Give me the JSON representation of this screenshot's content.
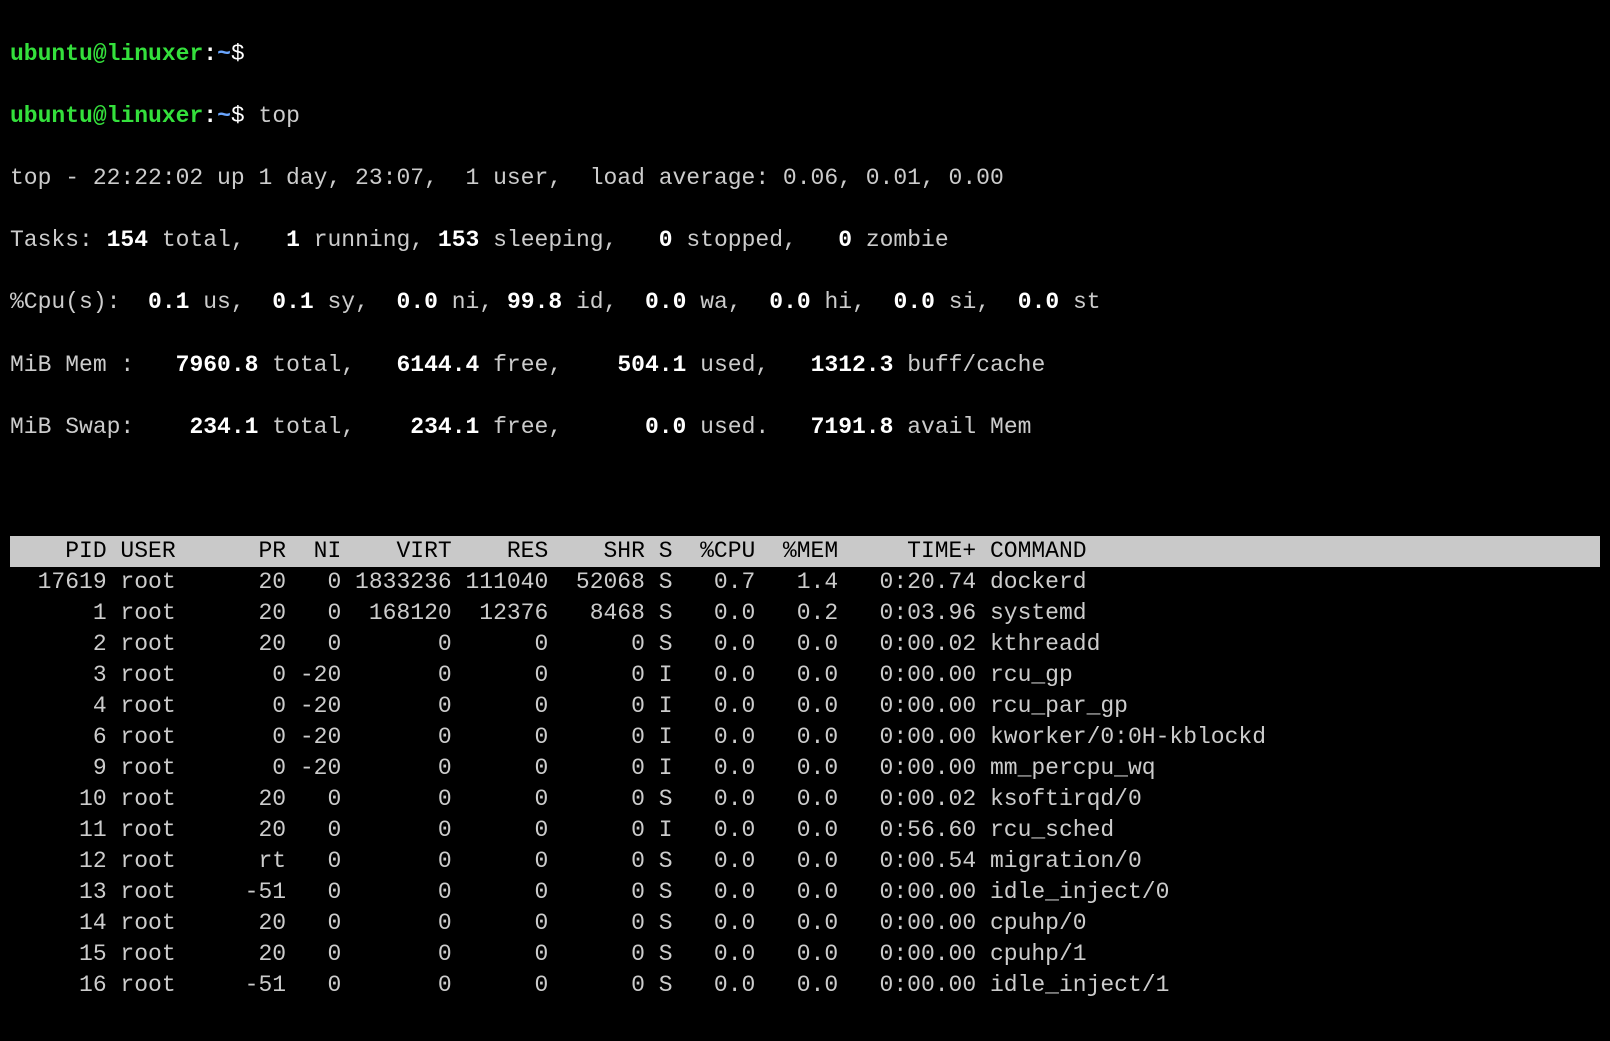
{
  "prompt": {
    "user": "ubuntu",
    "at": "@",
    "host": "linuxer",
    "colon": ":",
    "path": "~",
    "dollar": "$"
  },
  "commands": {
    "blank": "",
    "top": "top"
  },
  "summary": {
    "l1_a": "top - 22:22:02 up 1 day, 23:07,  1 user,  load average: 0.06, 0.01, 0.00",
    "tasks_label": "Tasks:",
    "tasks_total": " 154 ",
    "tasks_total_lbl": "total,",
    "tasks_run": "   1 ",
    "tasks_run_lbl": "running,",
    "tasks_sleep": " 153 ",
    "tasks_sleep_lbl": "sleeping,",
    "tasks_stop": "   0 ",
    "tasks_stop_lbl": "stopped,",
    "tasks_zomb": "   0 ",
    "tasks_zomb_lbl": "zombie",
    "cpu_label": "%Cpu(s):",
    "cpu_us": "  0.1 ",
    "cpu_us_lbl": "us,",
    "cpu_sy": "  0.1 ",
    "cpu_sy_lbl": "sy,",
    "cpu_ni": "  0.0 ",
    "cpu_ni_lbl": "ni,",
    "cpu_id": " 99.8 ",
    "cpu_id_lbl": "id,",
    "cpu_wa": "  0.0 ",
    "cpu_wa_lbl": "wa,",
    "cpu_hi": "  0.0 ",
    "cpu_hi_lbl": "hi,",
    "cpu_si": "  0.0 ",
    "cpu_si_lbl": "si,",
    "cpu_st": "  0.0 ",
    "cpu_st_lbl": "st",
    "mem_label": "MiB Mem :",
    "mem_total": "   7960.8 ",
    "mem_total_lbl": "total,",
    "mem_free": "   6144.4 ",
    "mem_free_lbl": "free,",
    "mem_used": "    504.1 ",
    "mem_used_lbl": "used,",
    "mem_buff": "   1312.3 ",
    "mem_buff_lbl": "buff/cache",
    "swap_label": "MiB Swap:",
    "swap_total": "    234.1 ",
    "swap_total_lbl": "total,",
    "swap_free": "    234.1 ",
    "swap_free_lbl": "free,",
    "swap_used": "      0.0 ",
    "swap_used_lbl": "used.",
    "swap_avail": "   7191.8 ",
    "swap_avail_lbl": "avail Mem"
  },
  "header": "    PID USER      PR  NI    VIRT    RES    SHR S  %CPU  %MEM     TIME+ COMMAND                         ",
  "rows": [
    "  17619 root      20   0 1833236 111040  52068 S   0.7   1.4   0:20.74 dockerd",
    "      1 root      20   0  168120  12376   8468 S   0.0   0.2   0:03.96 systemd",
    "      2 root      20   0       0      0      0 S   0.0   0.0   0:00.02 kthreadd",
    "      3 root       0 -20       0      0      0 I   0.0   0.0   0:00.00 rcu_gp",
    "      4 root       0 -20       0      0      0 I   0.0   0.0   0:00.00 rcu_par_gp",
    "      6 root       0 -20       0      0      0 I   0.0   0.0   0:00.00 kworker/0:0H-kblockd",
    "      9 root       0 -20       0      0      0 I   0.0   0.0   0:00.00 mm_percpu_wq",
    "     10 root      20   0       0      0      0 S   0.0   0.0   0:00.02 ksoftirqd/0",
    "     11 root      20   0       0      0      0 I   0.0   0.0   0:56.60 rcu_sched",
    "     12 root      rt   0       0      0      0 S   0.0   0.0   0:00.54 migration/0",
    "     13 root     -51   0       0      0      0 S   0.0   0.0   0:00.00 idle_inject/0",
    "     14 root      20   0       0      0      0 S   0.0   0.0   0:00.00 cpuhp/0",
    "     15 root      20   0       0      0      0 S   0.0   0.0   0:00.00 cpuhp/1",
    "     16 root     -51   0       0      0      0 S   0.0   0.0   0:00.00 idle_inject/1"
  ],
  "chart_data": {
    "type": "table",
    "columns": [
      "PID",
      "USER",
      "PR",
      "NI",
      "VIRT",
      "RES",
      "SHR",
      "S",
      "%CPU",
      "%MEM",
      "TIME+",
      "COMMAND"
    ],
    "rows": [
      [
        17619,
        "root",
        "20",
        0,
        1833236,
        111040,
        52068,
        "S",
        0.7,
        1.4,
        "0:20.74",
        "dockerd"
      ],
      [
        1,
        "root",
        "20",
        0,
        168120,
        12376,
        8468,
        "S",
        0.0,
        0.2,
        "0:03.96",
        "systemd"
      ],
      [
        2,
        "root",
        "20",
        0,
        0,
        0,
        0,
        "S",
        0.0,
        0.0,
        "0:00.02",
        "kthreadd"
      ],
      [
        3,
        "root",
        "0",
        -20,
        0,
        0,
        0,
        "I",
        0.0,
        0.0,
        "0:00.00",
        "rcu_gp"
      ],
      [
        4,
        "root",
        "0",
        -20,
        0,
        0,
        0,
        "I",
        0.0,
        0.0,
        "0:00.00",
        "rcu_par_gp"
      ],
      [
        6,
        "root",
        "0",
        -20,
        0,
        0,
        0,
        "I",
        0.0,
        0.0,
        "0:00.00",
        "kworker/0:0H-kblockd"
      ],
      [
        9,
        "root",
        "0",
        -20,
        0,
        0,
        0,
        "I",
        0.0,
        0.0,
        "0:00.00",
        "mm_percpu_wq"
      ],
      [
        10,
        "root",
        "20",
        0,
        0,
        0,
        0,
        "S",
        0.0,
        0.0,
        "0:00.02",
        "ksoftirqd/0"
      ],
      [
        11,
        "root",
        "20",
        0,
        0,
        0,
        0,
        "I",
        0.0,
        0.0,
        "0:56.60",
        "rcu_sched"
      ],
      [
        12,
        "root",
        "rt",
        0,
        0,
        0,
        0,
        "S",
        0.0,
        0.0,
        "0:00.54",
        "migration/0"
      ],
      [
        13,
        "root",
        "-51",
        0,
        0,
        0,
        0,
        "S",
        0.0,
        0.0,
        "0:00.00",
        "idle_inject/0"
      ],
      [
        14,
        "root",
        "20",
        0,
        0,
        0,
        0,
        "S",
        0.0,
        0.0,
        "0:00.00",
        "cpuhp/0"
      ],
      [
        15,
        "root",
        "20",
        0,
        0,
        0,
        0,
        "S",
        0.0,
        0.0,
        "0:00.00",
        "cpuhp/1"
      ],
      [
        16,
        "root",
        "-51",
        0,
        0,
        0,
        0,
        "S",
        0.0,
        0.0,
        "0:00.00",
        "idle_inject/1"
      ]
    ]
  }
}
